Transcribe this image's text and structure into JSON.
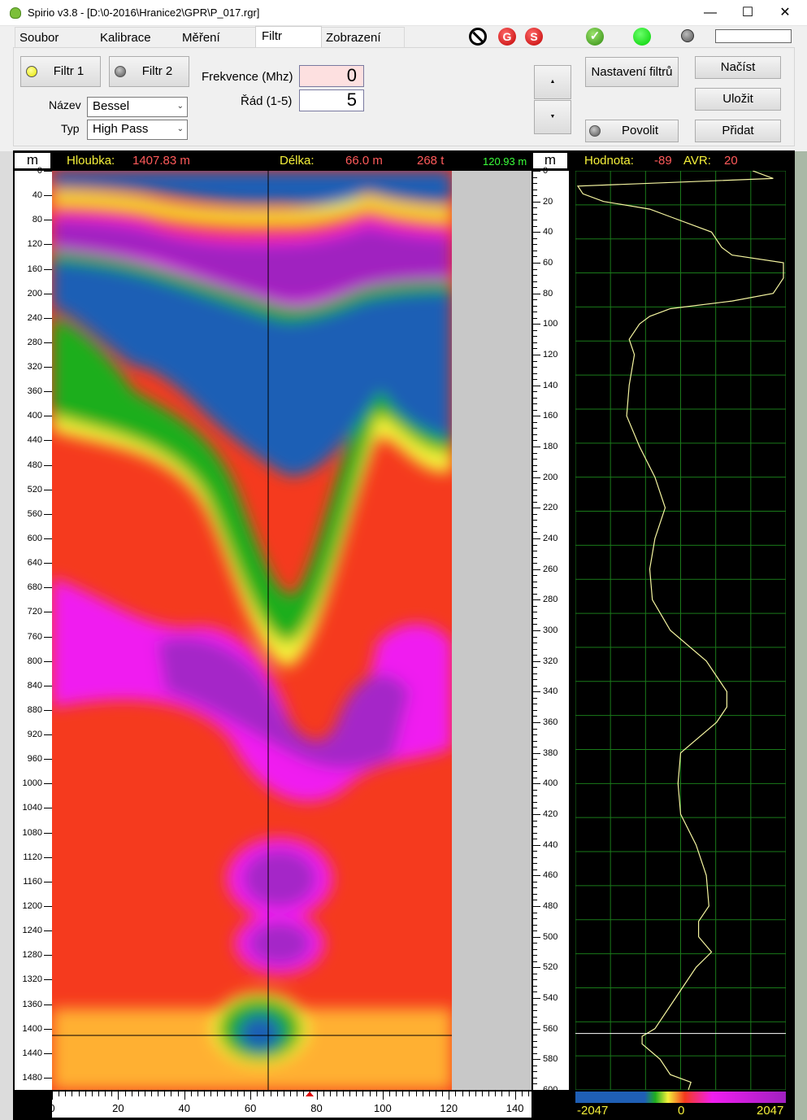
{
  "window": {
    "title": "Spirio v3.8 - [D:\\0-2016\\Hranice2\\GPR\\P_017.rgr]",
    "minimize": "—",
    "maximize": "☐",
    "close": "✕"
  },
  "menu": {
    "items": [
      "Soubor",
      "Kalibrace",
      "Měření",
      "Filtr",
      "Zobrazení"
    ],
    "active": "Filtr"
  },
  "status_icons": {
    "stop": "⊘",
    "g_label": "G",
    "s_label": "S",
    "ok": "✓"
  },
  "filter_panel": {
    "filtr1_label": "Filtr 1",
    "filtr2_label": "Filtr 2",
    "nazev_label": "Název",
    "nazev_value": "Bessel",
    "typ_label": "Typ",
    "typ_value": "High Pass",
    "frekvence_label": "Frekvence (Mhz)",
    "frekvence_value": "0",
    "rad_label": "Řád (1-5)",
    "rad_value": "5",
    "up_label": "▲",
    "down_label": "▼",
    "nastaveni_label": "Nastavení filtrů",
    "povolit_label": "Povolit",
    "nacist_label": "Načíst",
    "ulozit_label": "Uložit",
    "pridat_label": "Přidat"
  },
  "readout": {
    "unit_left": "m",
    "hloubka_label": "Hloubka:",
    "hloubka_value": "1407.83 m",
    "delka_label": "Délka:",
    "delka_value": "66.0 m",
    "traces_value": "268 t",
    "green_value": "120.93 m",
    "unit_mid": "m",
    "hodnota_label": "Hodnota:",
    "hodnota_value": "-89",
    "avr_label": "AVR:",
    "avr_value": "20"
  },
  "colors": {
    "blue": "#1f5fb5",
    "green": "#1fae1f",
    "yellow": "#f5f03a",
    "red": "#f53a1e",
    "magenta": "#f01ef0",
    "purple": "#a020c0",
    "trace": "#f5f5a0"
  },
  "chart_data": {
    "type": "heatmap",
    "left_axis": {
      "unit": "m",
      "ticks": [
        0,
        40,
        80,
        120,
        160,
        200,
        240,
        280,
        320,
        360,
        400,
        440,
        480,
        520,
        560,
        600,
        640,
        680,
        720,
        760,
        800,
        840,
        880,
        920,
        960,
        1000,
        1040,
        1080,
        1120,
        1160,
        1200,
        1240,
        1280,
        1320,
        1360,
        1400,
        1440,
        1480
      ],
      "range": [
        0,
        1500
      ]
    },
    "bottom_axis": {
      "unit": "m",
      "ticks": [
        0,
        20,
        40,
        60,
        80,
        100,
        120,
        140
      ],
      "range": [
        0,
        145
      ]
    },
    "mid_axis": {
      "unit": "m",
      "ticks": [
        0,
        20,
        40,
        60,
        80,
        100,
        120,
        140,
        160,
        180,
        200,
        220,
        240,
        260,
        280,
        300,
        320,
        340,
        360,
        380,
        400,
        420,
        440,
        460,
        480,
        500,
        520,
        540,
        560,
        580,
        600
      ],
      "range": [
        0,
        600
      ]
    },
    "cursor": {
      "x": 66.0,
      "depth": 1407.83
    },
    "colorbar": {
      "min_label": "-2047",
      "mid_label": "0",
      "max_label": "2047"
    },
    "trace": {
      "x_range": [
        -2047,
        2047
      ],
      "depth_values": [
        0,
        5,
        10,
        15,
        20,
        25,
        30,
        40,
        50,
        55,
        60,
        65,
        70,
        75,
        80,
        85,
        90,
        95,
        100,
        110,
        120,
        140,
        160,
        180,
        200,
        220,
        240,
        260,
        280,
        300,
        320,
        340,
        350,
        360,
        380,
        400,
        420,
        440,
        460,
        480,
        490,
        500,
        510,
        520,
        540,
        560,
        565,
        570,
        580,
        590,
        595,
        600
      ],
      "amplitudes": [
        1400,
        1800,
        -2000,
        -1900,
        -1500,
        -600,
        -200,
        600,
        800,
        1000,
        2000,
        2000,
        2000,
        1900,
        1800,
        1000,
        -200,
        -600,
        -800,
        -1000,
        -900,
        -1000,
        -1050,
        -800,
        -500,
        -300,
        -500,
        -600,
        -550,
        -200,
        500,
        900,
        900,
        700,
        0,
        -50,
        0,
        300,
        500,
        550,
        350,
        350,
        600,
        300,
        -100,
        -500,
        -750,
        -750,
        -400,
        -200,
        200,
        150
      ]
    }
  }
}
